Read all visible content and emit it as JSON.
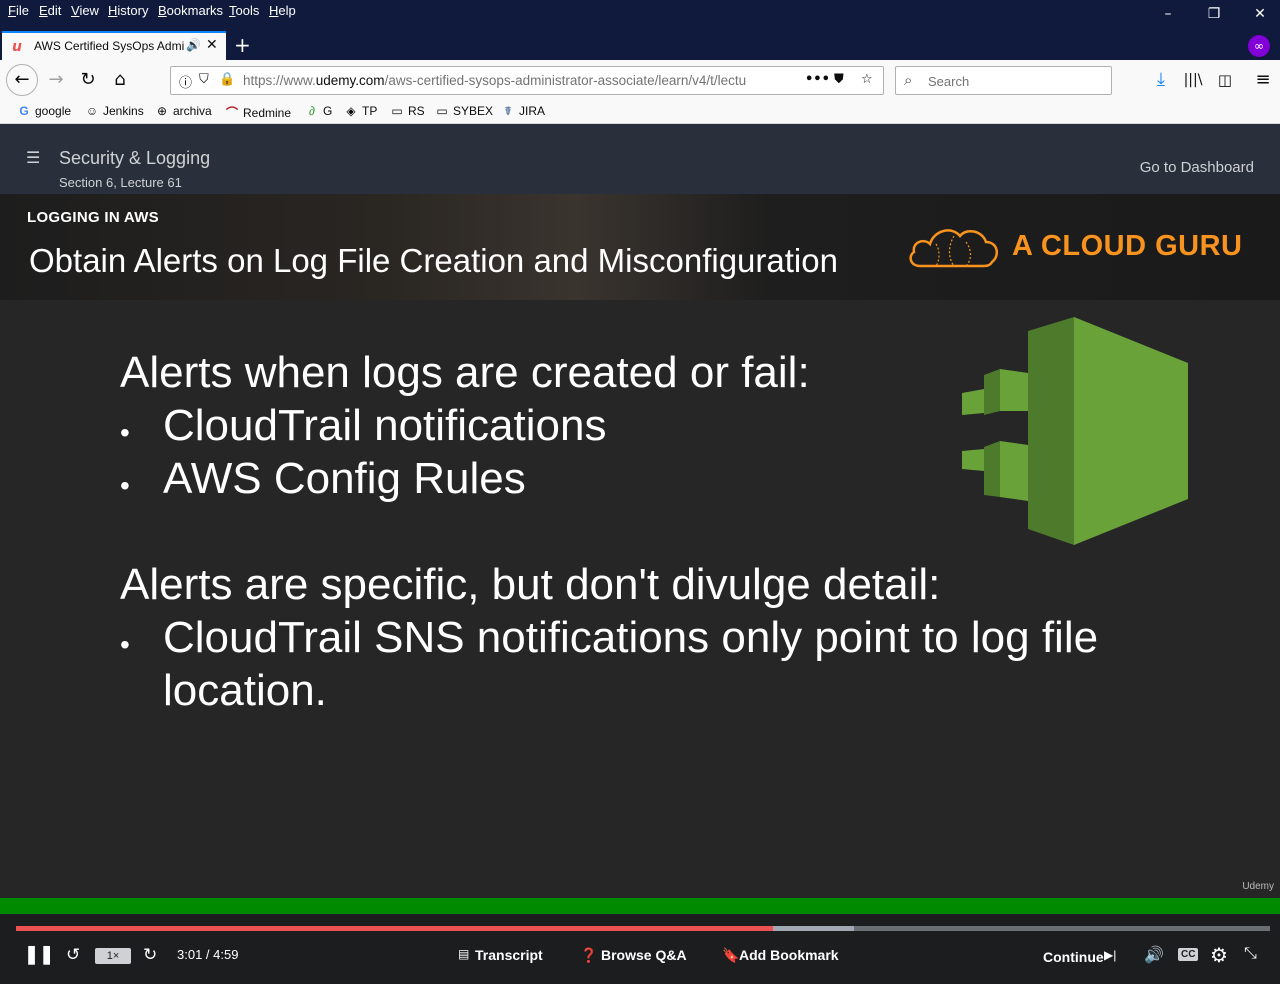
{
  "menu": [
    "File",
    "Edit",
    "View",
    "History",
    "Bookmarks",
    "Tools",
    "Help"
  ],
  "tab": {
    "title": "AWS Certified SysOps Admi",
    "new_tab_label": "+"
  },
  "navbar": {
    "url_prefix": "https://www.",
    "url_domain": "udemy.com",
    "url_path": "/aws-certified-sysops-administrator-associate/learn/v4/t/lectu",
    "search_placeholder": "Search"
  },
  "bookmarks": [
    {
      "label": "google",
      "icon": "G"
    },
    {
      "label": "Jenkins",
      "icon": "☺"
    },
    {
      "label": "archiva",
      "icon": "⊕"
    },
    {
      "label": "Redmine",
      "icon": "⌒"
    },
    {
      "label": "G",
      "icon": "∂"
    },
    {
      "label": "TP",
      "icon": "◈"
    },
    {
      "label": "RS",
      "icon": "▭"
    },
    {
      "label": "SYBEX",
      "icon": "▭"
    },
    {
      "label": "JIRA",
      "icon": "☤"
    }
  ],
  "lecture": {
    "title": "Security & Logging",
    "subtitle": "Section 6, Lecture 61",
    "dashboard_link": "Go to Dashboard"
  },
  "slide": {
    "kicker": "LOGGING IN AWS",
    "title": "Obtain Alerts on Log File Creation and Misconfiguration",
    "brand": "A CLOUD GURU",
    "heading1": "Alerts when logs are created or fail:",
    "bullets1": [
      "CloudTrail notifications",
      "AWS Config Rules"
    ],
    "heading2": "Alerts are specific, but don't divulge detail:",
    "bullets2_line1": "CloudTrail SNS notifications only point to log file",
    "bullets2_line2": "location.",
    "watermark": "Udemy"
  },
  "player": {
    "speed": "1×",
    "time": "3:01 / 4:59",
    "progress_fraction": 0.604,
    "buffered_fraction": 0.668,
    "transcript": "Transcript",
    "browse_qa": "Browse Q&A",
    "add_bookmark": "Add Bookmark",
    "continue": "Continue"
  },
  "colors": {
    "accent": "#ec5252",
    "brand_orange": "#f7931e",
    "aws_green": "#6aa23a",
    "status_green": "#008a00"
  }
}
